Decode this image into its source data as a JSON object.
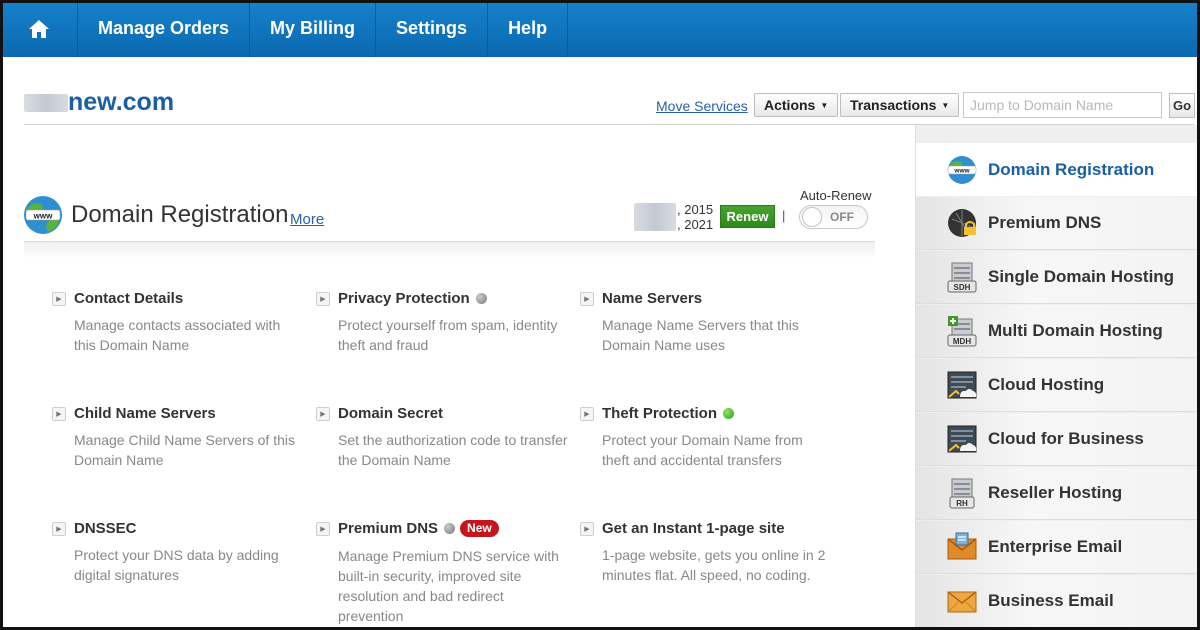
{
  "nav": {
    "items": [
      "Manage Orders",
      "My Billing",
      "Settings",
      "Help"
    ]
  },
  "header": {
    "domain_suffix": "new.com",
    "move_services": "Move Services",
    "actions_label": "Actions",
    "transactions_label": "Transactions",
    "jump_placeholder": "Jump to Domain Name",
    "go_label": "Go"
  },
  "section": {
    "title": "Domain Registration",
    "more_label": "More",
    "date_line1": ", 2015",
    "date_line2": ", 2021",
    "renew_label": "Renew",
    "separator": "|",
    "auto_renew_label": "Auto-Renew",
    "toggle_state": "OFF"
  },
  "cards": [
    {
      "title": "Contact Details",
      "desc": "Manage contacts associated with this Domain Name"
    },
    {
      "title": "Privacy Protection",
      "desc": "Protect yourself from spam, identity theft and fraud",
      "status": "gray"
    },
    {
      "title": "Name Servers",
      "desc": "Manage Name Servers that this Domain Name uses"
    },
    {
      "title": "Child Name Servers",
      "desc": "Manage Child Name Servers of this Domain Name"
    },
    {
      "title": "Domain Secret",
      "desc": "Set the authorization code to transfer the Domain Name"
    },
    {
      "title": "Theft Protection",
      "desc": "Protect your Domain Name from theft and accidental transfers",
      "status": "green"
    },
    {
      "title": "DNSSEC",
      "desc": "Protect your DNS data by adding digital signatures"
    },
    {
      "title": "Premium DNS",
      "desc": "Manage Premium DNS service with built-in security, improved site resolution and bad redirect prevention",
      "status": "gray",
      "badge": "New"
    },
    {
      "title": "Get an Instant 1-page site",
      "desc": "1-page website, gets you online in 2 minutes flat. All speed, no coding."
    }
  ],
  "sidebar": {
    "items": [
      {
        "label": "Domain Registration",
        "icon": "www-globe-icon",
        "active": true
      },
      {
        "label": "Premium DNS",
        "icon": "premium-dns-icon"
      },
      {
        "label": "Single Domain Hosting",
        "icon": "sdh-server-icon",
        "tag": "SDH"
      },
      {
        "label": "Multi Domain Hosting",
        "icon": "mdh-server-icon",
        "tag": "MDH"
      },
      {
        "label": "Cloud Hosting",
        "icon": "cloud-hosting-icon"
      },
      {
        "label": "Cloud for Business",
        "icon": "cloud-business-icon"
      },
      {
        "label": "Reseller Hosting",
        "icon": "rh-server-icon",
        "tag": "RH"
      },
      {
        "label": "Enterprise Email",
        "icon": "enterprise-email-icon"
      },
      {
        "label": "Business Email",
        "icon": "business-email-icon"
      }
    ]
  },
  "colors": {
    "nav_bg": "#0b68b0",
    "link": "#2a62a8",
    "domain_title": "#1b5ea8",
    "renew_green": "#2f8a1d",
    "new_badge_red": "#c4161c",
    "status_green": "#2c9a15"
  }
}
